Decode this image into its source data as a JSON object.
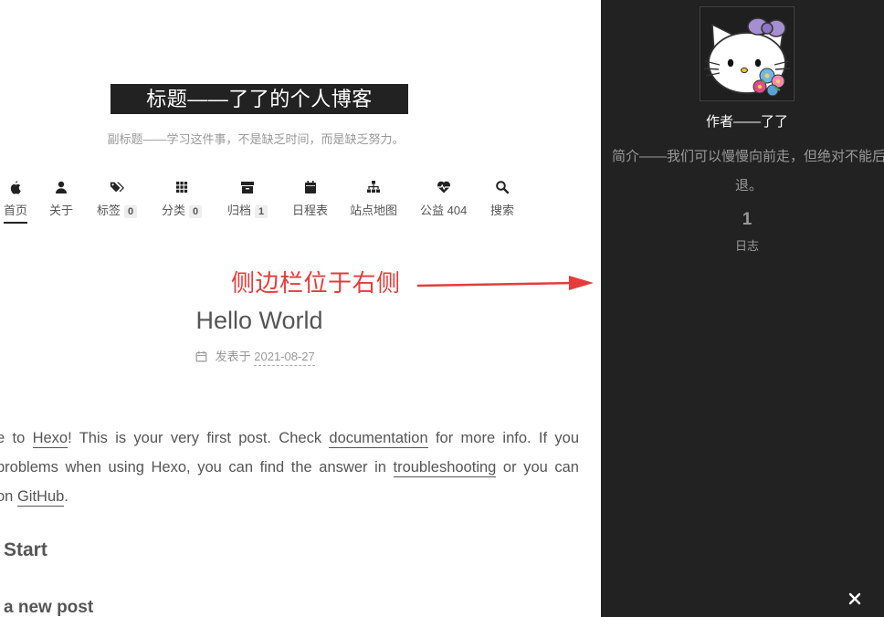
{
  "site": {
    "title": "标题——了了的个人博客",
    "subtitle": "副标题——学习这件事，不是缺乏时间，而是缺乏努力。"
  },
  "nav": {
    "items": [
      {
        "label": "首页",
        "icon": "home-icon"
      },
      {
        "label": "关于",
        "icon": "user-icon"
      },
      {
        "label": "标签",
        "icon": "tags-icon",
        "badge": "0"
      },
      {
        "label": "分类",
        "icon": "grid-icon",
        "badge": "0"
      },
      {
        "label": "归档",
        "icon": "archive-icon",
        "badge": "1"
      },
      {
        "label": "日程表",
        "icon": "calendar-icon"
      },
      {
        "label": "站点地图",
        "icon": "sitemap-icon"
      },
      {
        "label": "公益 404",
        "icon": "heartbeat-icon"
      },
      {
        "label": "搜索",
        "icon": "search-icon"
      }
    ]
  },
  "annotation": {
    "text": "侧边栏位于右侧",
    "color": "#e63b3b"
  },
  "post": {
    "title": "Hello World",
    "meta_label": "发表于",
    "date": "2021-08-27",
    "lines": [
      [
        "e to ",
        "Hexo",
        "! This is your very first post. Check ",
        "documentation",
        " for more info. If you"
      ],
      [
        "problems when using Hexo, you can find the answer in ",
        "troubleshooting",
        " or you can"
      ],
      [
        "on ",
        "GitHub",
        "."
      ]
    ],
    "heading_quick_start": "Start",
    "heading_create_post": "a new post"
  },
  "sidebar": {
    "author_name": "作者——了了",
    "description": "简介——我们可以慢慢向前走，但绝对不能后退。",
    "stat_count": "1",
    "stat_label": "日志",
    "close_icon": "close-icon",
    "bg_color": "#222222"
  }
}
